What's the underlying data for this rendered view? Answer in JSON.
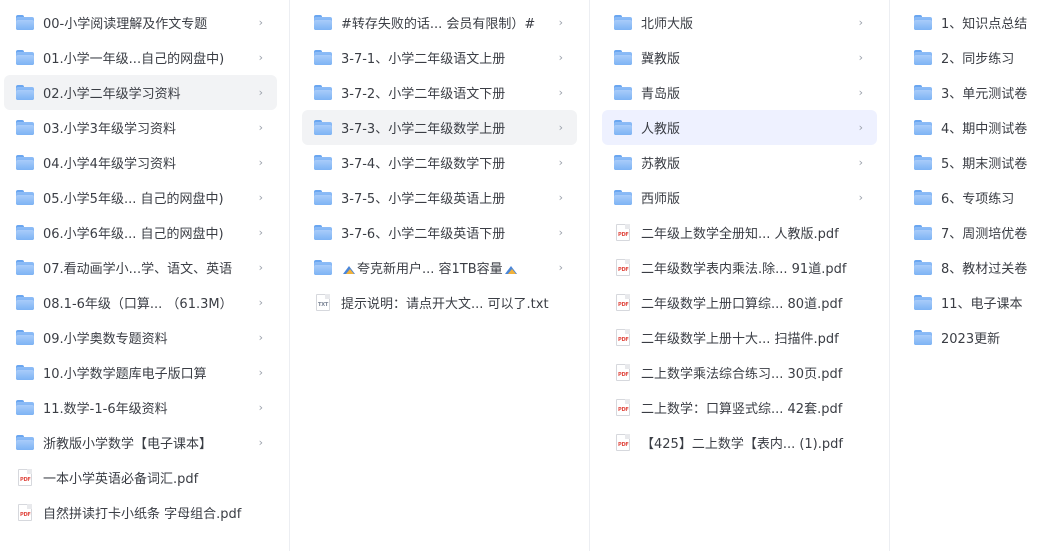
{
  "columns": [
    {
      "items": [
        {
          "type": "folder",
          "label": "00-小学阅读理解及作文专题"
        },
        {
          "type": "folder",
          "label": "01.小学一年级...自己的网盘中)"
        },
        {
          "type": "folder",
          "label": "02.小学二年级学习资料",
          "selected": "gray"
        },
        {
          "type": "folder",
          "label": "03.小学3年级学习资料"
        },
        {
          "type": "folder",
          "label": "04.小学4年级学习资料"
        },
        {
          "type": "folder",
          "label": "05.小学5年级... 自己的网盘中)"
        },
        {
          "type": "folder",
          "label": "06.小学6年级... 自己的网盘中)"
        },
        {
          "type": "folder",
          "label": "07.看动画学小...学、语文、英语"
        },
        {
          "type": "folder",
          "label": "08.1-6年级（口算... （61.3M）"
        },
        {
          "type": "folder",
          "label": "09.小学奥数专题资料"
        },
        {
          "type": "folder",
          "label": "10.小学数学题库电子版口算"
        },
        {
          "type": "folder",
          "label": "11.数学-1-6年级资料"
        },
        {
          "type": "folder",
          "label": "浙教版小学数学【电子课本】"
        },
        {
          "type": "pdf",
          "label": "一本小学英语必备词汇.pdf"
        },
        {
          "type": "pdf",
          "label": "自然拼读打卡小纸条 字母组合.pdf"
        }
      ]
    },
    {
      "items": [
        {
          "type": "folder",
          "label": "#转存失败的话... 会员有限制）#"
        },
        {
          "type": "folder",
          "label": "3-7-1、小学二年级语文上册"
        },
        {
          "type": "folder",
          "label": "3-7-2、小学二年级语文下册"
        },
        {
          "type": "folder",
          "label": "3-7-3、小学二年级数学上册",
          "selected": "gray"
        },
        {
          "type": "folder",
          "label": "3-7-4、小学二年级数学下册"
        },
        {
          "type": "folder",
          "label": "3-7-5、小学二年级英语上册"
        },
        {
          "type": "folder",
          "label": "3-7-6、小学二年级英语下册"
        },
        {
          "type": "folder",
          "label": "夸克新用户...  容1TB容量",
          "emoji": true
        },
        {
          "type": "txt",
          "label": "提示说明：请点开大文... 可以了.txt"
        }
      ]
    },
    {
      "items": [
        {
          "type": "folder",
          "label": "北师大版"
        },
        {
          "type": "folder",
          "label": "冀教版"
        },
        {
          "type": "folder",
          "label": "青岛版"
        },
        {
          "type": "folder",
          "label": "人教版",
          "selected": "blue"
        },
        {
          "type": "folder",
          "label": "苏教版"
        },
        {
          "type": "folder",
          "label": "西师版"
        },
        {
          "type": "pdf",
          "label": "二年级上数学全册知...  人教版.pdf"
        },
        {
          "type": "pdf",
          "label": "二年级数学表内乘法.除... 91道.pdf"
        },
        {
          "type": "pdf",
          "label": "二年级数学上册口算综... 80道.pdf"
        },
        {
          "type": "pdf",
          "label": "二年级数学上册十大...  扫描件.pdf"
        },
        {
          "type": "pdf",
          "label": "二上数学乘法综合练习... 30页.pdf"
        },
        {
          "type": "pdf",
          "label": "二上数学：口算竖式综... 42套.pdf"
        },
        {
          "type": "pdf",
          "label": "【425】二上数学【表内...  (1).pdf"
        }
      ]
    },
    {
      "items": [
        {
          "type": "folder",
          "label": "1、知识点总结"
        },
        {
          "type": "folder",
          "label": "2、同步练习"
        },
        {
          "type": "folder",
          "label": "3、单元测试卷"
        },
        {
          "type": "folder",
          "label": "4、期中测试卷"
        },
        {
          "type": "folder",
          "label": "5、期末测试卷"
        },
        {
          "type": "folder",
          "label": "6、专项练习"
        },
        {
          "type": "folder",
          "label": "7、周测培优卷"
        },
        {
          "type": "folder",
          "label": "8、教材过关卷"
        },
        {
          "type": "folder",
          "label": "11、电子课本"
        },
        {
          "type": "folder",
          "label": "2023更新",
          "no_chevron": true
        }
      ]
    }
  ],
  "icon_tags": {
    "pdf": "PDF",
    "txt": "TXT"
  },
  "chevron_glyph": "›",
  "colors": {
    "folder": "#6aa6f0",
    "selected_gray": "#f2f3f5",
    "selected_blue": "#eef1ff",
    "pdf_red": "#e0473f"
  }
}
